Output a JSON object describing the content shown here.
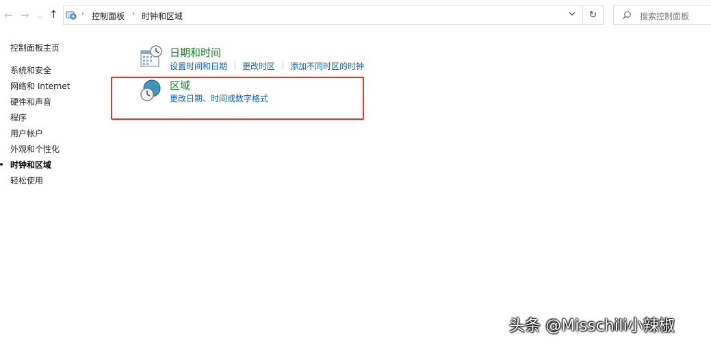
{
  "nav_buttons": {
    "back": "←",
    "forward": "→",
    "recent": "⌵",
    "up": "↑"
  },
  "address": {
    "icon": "control-panel-icon",
    "breadcrumbs": [
      "控制面板",
      "时钟和区域"
    ],
    "separator": "›"
  },
  "refresh_glyph": "↻",
  "search": {
    "placeholder": "搜索控制面板"
  },
  "sidebar": {
    "home": "控制面板主页",
    "items": [
      {
        "label": "系统和安全"
      },
      {
        "label": "网络和 Internet"
      },
      {
        "label": "硬件和声音"
      },
      {
        "label": "程序"
      },
      {
        "label": "用户帐户"
      },
      {
        "label": "外观和个性化"
      },
      {
        "label": "时钟和区域",
        "current": true
      },
      {
        "label": "轻松使用"
      }
    ]
  },
  "categories": [
    {
      "title": "日期和时间",
      "icon": "calendar-clock-icon",
      "links": [
        "设置时间和日期",
        "更改时区",
        "添加不同时区的时钟"
      ]
    },
    {
      "title": "区域",
      "icon": "globe-clock-icon",
      "links": [
        "更改日期、时间或数字格式"
      ]
    }
  ],
  "colors": {
    "category_title": "#1a7a2a",
    "link": "#0b5fae",
    "highlight_border": "#e13434"
  },
  "watermark": "头条 @Misschili小辣椒"
}
